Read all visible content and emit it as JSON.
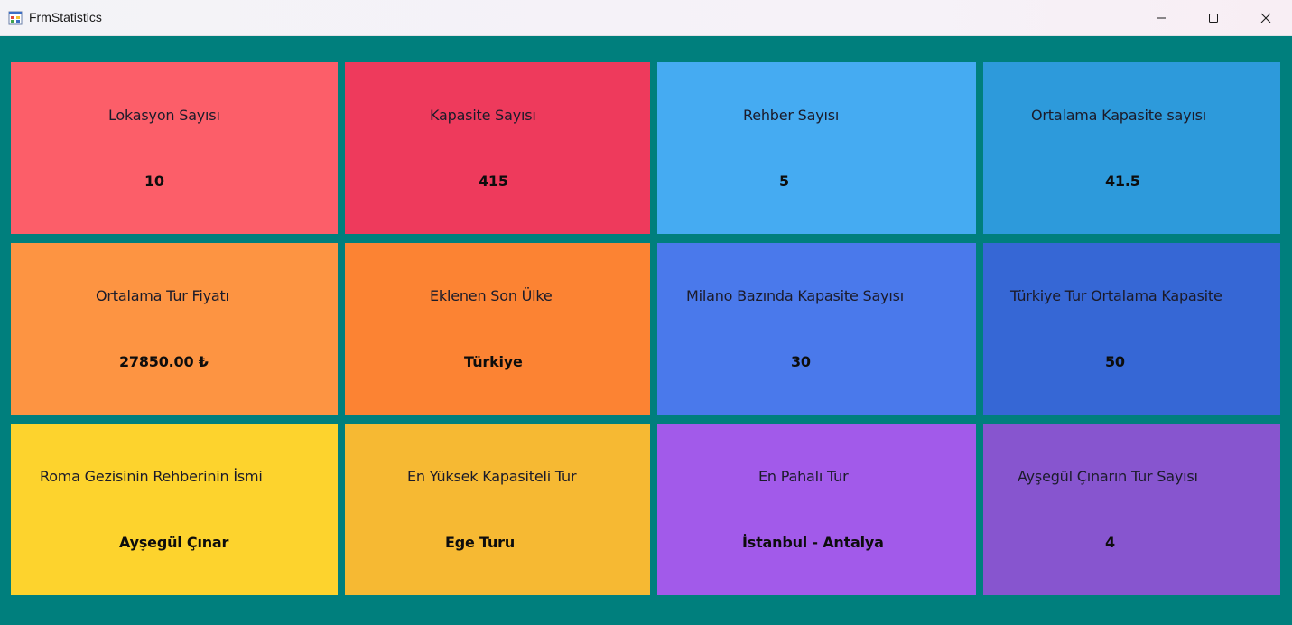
{
  "window": {
    "title": "FrmStatistics",
    "minimize_glyph": "minimize-icon",
    "maximize_glyph": "maximize-icon",
    "close_glyph": "close-icon"
  },
  "colors": {
    "background": "#007f7d",
    "red": "#fc5e69",
    "crimson": "#ee3a5c",
    "sky": "#45abf2",
    "blue": "#2d9adb",
    "orange_light": "#fd9442",
    "orange": "#fc8333",
    "royal": "#4a79eb",
    "royal_dark": "#3667d5",
    "yellow": "#fdd32d",
    "amber": "#f6b933",
    "violet": "#a25aea",
    "purple": "#8755cf"
  },
  "cards": [
    {
      "label": "Lokasyon Sayısı",
      "value": "10"
    },
    {
      "label": "Kapasite Sayısı",
      "value": "415"
    },
    {
      "label": "Rehber Sayısı",
      "value": "5"
    },
    {
      "label": "Ortalama Kapasite sayısı",
      "value": "41.5"
    },
    {
      "label": "Ortalama Tur Fiyatı",
      "value": "27850.00 ₺"
    },
    {
      "label": "Eklenen Son Ülke",
      "value": "Türkiye"
    },
    {
      "label": "Milano Bazında Kapasite Sayısı",
      "value": "30"
    },
    {
      "label": "Türkiye Tur Ortalama Kapasite",
      "value": "50"
    },
    {
      "label": "Roma Gezisinin Rehberinin İsmi",
      "value": "Ayşegül Çınar"
    },
    {
      "label": "En Yüksek Kapasiteli Tur",
      "value": "Ege Turu"
    },
    {
      "label": "En Pahalı Tur",
      "value": "İstanbul - Antalya"
    },
    {
      "label": "Ayşegül Çınarın Tur Sayısı",
      "value": "4"
    }
  ]
}
